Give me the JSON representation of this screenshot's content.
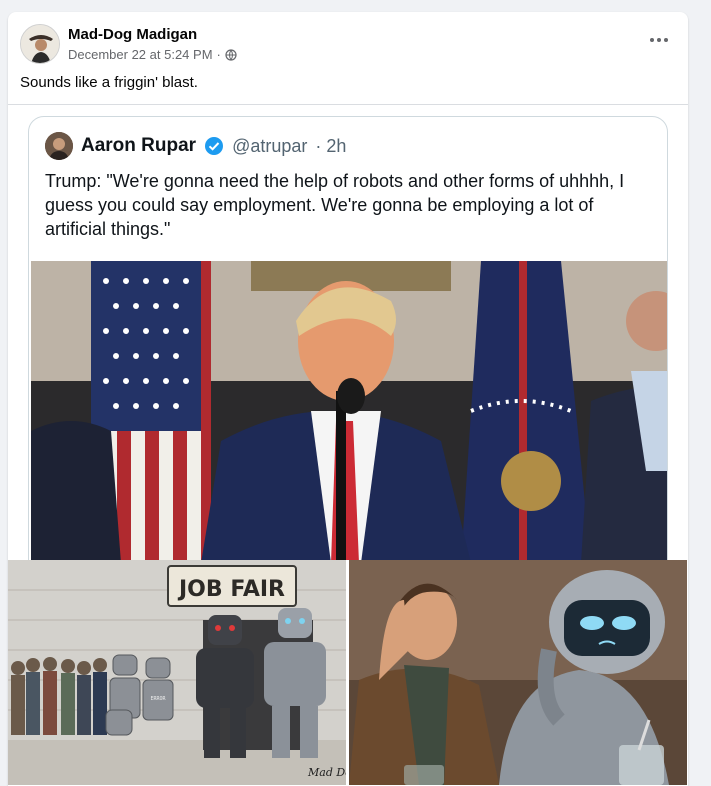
{
  "post": {
    "author": "Mad-Dog Madigan",
    "timestamp": "December 22 at 5:24 PM",
    "separator": "·",
    "privacy_icon": "globe-icon",
    "more_icon": "more-options-icon",
    "text": "Sounds like a friggin' blast."
  },
  "tweet": {
    "name": "Aaron Rupar",
    "verified_icon": "verified-badge-icon",
    "handle": "@atrupar",
    "age": "· 2h",
    "text": "Trump: \"We're gonna need the help of robots and other forms of uhhhh, I guess you could say employment. We're gonna be employing a lot of artificial things.\""
  },
  "images": {
    "job_fair_sign": "JOB FAIR",
    "error_label": "ERROR",
    "signature": "Mad Dog-"
  },
  "colors": {
    "accent": "#1d9bf0",
    "meta_gray": "#65676b",
    "divider": "#dadde1"
  }
}
